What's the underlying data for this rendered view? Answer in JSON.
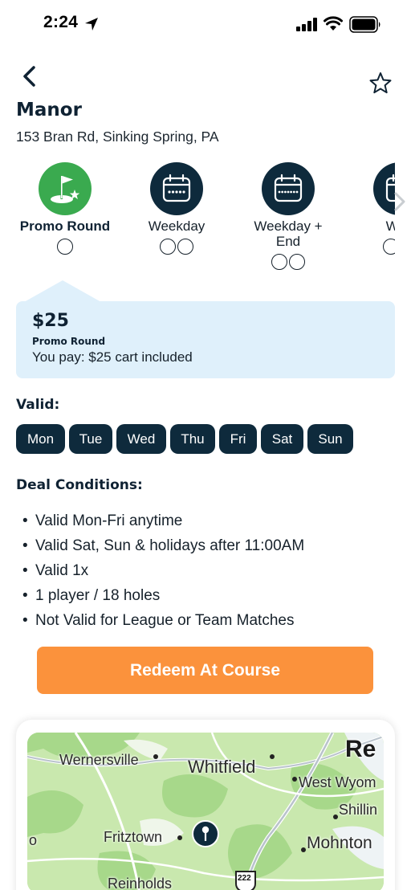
{
  "status_bar": {
    "time": "2:24"
  },
  "course": {
    "name": "Manor",
    "address": "153 Bran Rd, Sinking Spring, PA"
  },
  "deal_tabs": [
    {
      "label": "Promo Round",
      "coins": 1,
      "icon": "flag-icon"
    },
    {
      "label": "Weekday",
      "coins": 2,
      "icon": "calendar-icon"
    },
    {
      "label": "Weekday + End",
      "coins": 2,
      "icon": "calendar-icon"
    },
    {
      "label": "Wee",
      "coins": 2,
      "icon": "calendar-icon"
    }
  ],
  "price_card": {
    "amount": "$25",
    "type": "Promo Round",
    "description": "You pay: $25 cart included"
  },
  "valid": {
    "title": "Valid:",
    "days": [
      "Mon",
      "Tue",
      "Wed",
      "Thu",
      "Fri",
      "Sat",
      "Sun"
    ]
  },
  "conditions": {
    "title": "Deal Conditions:",
    "items": [
      "Valid Mon-Fri anytime",
      "Valid Sat, Sun & holidays after 11:00AM",
      "Valid 1x",
      "1 player / 18 holes",
      "Not Valid for League or Team Matches"
    ]
  },
  "redeem_button": "Redeem At Course",
  "map": {
    "labels": [
      "Wernersville",
      "Whitfield",
      "Re",
      "West Wyom",
      "Shillin",
      "o",
      "Fritztown",
      "Mohnton",
      "Reinholds"
    ],
    "route_shield": "222"
  },
  "colors": {
    "navy": "#0e2a3c",
    "green": "#3aaa4f",
    "orange": "#fb923c",
    "light_blue": "#dff0fb"
  }
}
